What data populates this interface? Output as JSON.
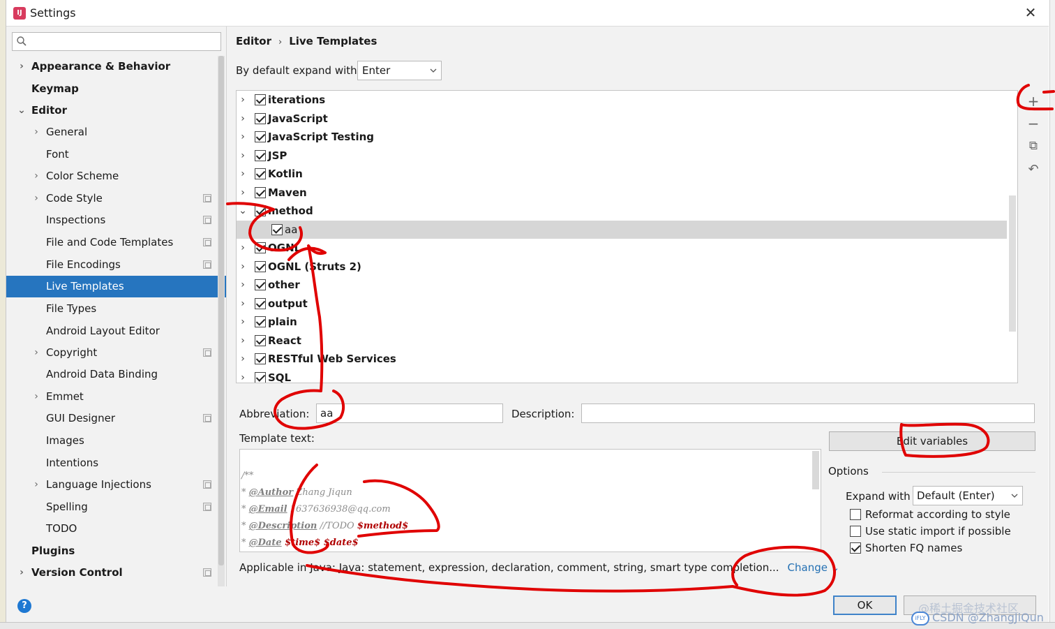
{
  "window": {
    "title": "Settings",
    "close_label": "✕"
  },
  "search": {
    "placeholder": ""
  },
  "sidebar": {
    "items": [
      {
        "label": "Appearance & Behavior",
        "level": 0,
        "bold": true,
        "chevron": "›"
      },
      {
        "label": "Keymap",
        "level": 0,
        "bold": true,
        "chevron": ""
      },
      {
        "label": "Editor",
        "level": 0,
        "bold": true,
        "chevron": "⌄"
      },
      {
        "label": "General",
        "level": 1,
        "chevron": "›"
      },
      {
        "label": "Font",
        "level": 1,
        "chevron": ""
      },
      {
        "label": "Color Scheme",
        "level": 1,
        "chevron": "›"
      },
      {
        "label": "Code Style",
        "level": 1,
        "chevron": "›",
        "project_icon": true
      },
      {
        "label": "Inspections",
        "level": 1,
        "chevron": "",
        "project_icon": true
      },
      {
        "label": "File and Code Templates",
        "level": 1,
        "chevron": "",
        "project_icon": true
      },
      {
        "label": "File Encodings",
        "level": 1,
        "chevron": "",
        "project_icon": true
      },
      {
        "label": "Live Templates",
        "level": 1,
        "chevron": "",
        "selected": true
      },
      {
        "label": "File Types",
        "level": 1,
        "chevron": ""
      },
      {
        "label": "Android Layout Editor",
        "level": 1,
        "chevron": ""
      },
      {
        "label": "Copyright",
        "level": 1,
        "chevron": "›",
        "project_icon": true
      },
      {
        "label": "Android Data Binding",
        "level": 1,
        "chevron": ""
      },
      {
        "label": "Emmet",
        "level": 1,
        "chevron": "›"
      },
      {
        "label": "GUI Designer",
        "level": 1,
        "chevron": "",
        "project_icon": true
      },
      {
        "label": "Images",
        "level": 1,
        "chevron": ""
      },
      {
        "label": "Intentions",
        "level": 1,
        "chevron": ""
      },
      {
        "label": "Language Injections",
        "level": 1,
        "chevron": "›",
        "project_icon": true
      },
      {
        "label": "Spelling",
        "level": 1,
        "chevron": "",
        "project_icon": true
      },
      {
        "label": "TODO",
        "level": 1,
        "chevron": ""
      },
      {
        "label": "Plugins",
        "level": 0,
        "bold": true,
        "chevron": ""
      },
      {
        "label": "Version Control",
        "level": 0,
        "bold": true,
        "chevron": "›",
        "project_icon": true
      }
    ]
  },
  "breadcrumb": {
    "section": "Editor",
    "separator": "›",
    "page": "Live Templates"
  },
  "expand_default": {
    "label": "By default expand with",
    "value": "Enter"
  },
  "templates": [
    {
      "label": "iterations",
      "checked": true,
      "chevron": "›"
    },
    {
      "label": "JavaScript",
      "checked": true,
      "chevron": "›"
    },
    {
      "label": "JavaScript Testing",
      "checked": true,
      "chevron": "›"
    },
    {
      "label": "JSP",
      "checked": true,
      "chevron": "›"
    },
    {
      "label": "Kotlin",
      "checked": true,
      "chevron": "›"
    },
    {
      "label": "Maven",
      "checked": true,
      "chevron": "›"
    },
    {
      "label": "method",
      "checked": true,
      "chevron": "⌄"
    },
    {
      "label": "aa",
      "checked": true,
      "chevron": "",
      "child": true,
      "selected": true
    },
    {
      "label": "OGNL",
      "checked": true,
      "chevron": "›"
    },
    {
      "label": "OGNL (Struts 2)",
      "checked": true,
      "chevron": "›"
    },
    {
      "label": "other",
      "checked": true,
      "chevron": "›"
    },
    {
      "label": "output",
      "checked": true,
      "chevron": "›"
    },
    {
      "label": "plain",
      "checked": true,
      "chevron": "›"
    },
    {
      "label": "React",
      "checked": true,
      "chevron": "›"
    },
    {
      "label": "RESTful Web Services",
      "checked": true,
      "chevron": "›"
    },
    {
      "label": "SQL",
      "checked": true,
      "chevron": "›"
    }
  ],
  "toolbar": {
    "add": "+",
    "remove": "−",
    "copy": "⧉",
    "revert": "↶"
  },
  "editor": {
    "abbreviation_label": "Abbreviation:",
    "abbreviation_value": "aa",
    "description_label": "Description:",
    "description_value": "",
    "template_text_label": "Template text:",
    "code": {
      "l1": "/**",
      "l2_star": "*",
      "l2_tag": "@Author",
      "l2_text": " Zhang Jiqun",
      "l3_star": "*",
      "l3_tag": "@Email",
      "l3_text": " 1637636938@qq.com",
      "l4_star": "*",
      "l4_tag": "@Description",
      "l4_text": " //TODO ",
      "l4_var": "$method$",
      "l5_star": "*",
      "l5_tag": "@Date",
      "l5_var": " $time$ $date$"
    },
    "edit_variables": "Edit variables",
    "options_label": "Options",
    "expand_with_label": "Expand with",
    "expand_with_value": "Default (Enter)",
    "reformat": {
      "label": "Reformat according to style",
      "checked": false
    },
    "static_import": {
      "label": "Use static import if possible",
      "checked": false
    },
    "shorten_fq": {
      "label": "Shorten FQ names",
      "checked": true
    },
    "applicable": "Applicable in Java: Java: statement, expression, declaration, comment, string, smart type completion...",
    "change_label": "Change ⌄"
  },
  "buttons": {
    "ok": "OK",
    "help": "?"
  },
  "watermark": {
    "line1": "@稀土掘金技术社区",
    "line2": "CSDN @ZhangJiQun",
    "logo": "iFLY"
  },
  "annotation_color": "#e00000",
  "accent_color": "#2675bf"
}
